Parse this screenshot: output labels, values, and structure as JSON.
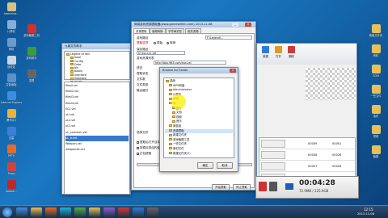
{
  "desktop_left": [
    {
      "label": "Administr...",
      "color": "#d8c089"
    },
    {
      "label": "计算机",
      "color": "#7fb0de"
    },
    {
      "label": "网络",
      "color": "#6a9bd0"
    },
    {
      "label": "回收站",
      "color": "#c8d6e6"
    },
    {
      "label": "控制面板",
      "color": "#5f91c9"
    },
    {
      "label": "Internet Explorer",
      "color": "#3c8fe0"
    },
    {
      "label": "腾讯QQ",
      "color": "#f0b030"
    },
    {
      "label": "迅雷",
      "color": "#3a7fd5"
    },
    {
      "label": "PPTV",
      "color": "#e86a2a"
    },
    {
      "label": "Fraps",
      "color": "#d0453b"
    },
    {
      "label": "Adobe...",
      "color": "#c02828"
    }
  ],
  "desktop_col2": [
    {
      "label": "游戏截图工具",
      "color": "#c33"
    },
    {
      "label": "游戏助手",
      "color": "#3b9b3b"
    },
    {
      "label": "录屏",
      "color": "#666"
    }
  ],
  "desktop_right": [
    {
      "label": "新建文件夹",
      "color": "#e6c15a"
    },
    {
      "label": "资料",
      "color": "#e6c15a"
    },
    {
      "label": "GOM",
      "color": "#e6c15a"
    },
    {
      "label": "一些文件",
      "color": "#e6c15a"
    },
    {
      "label": "素材",
      "color": "#e6c15a"
    },
    {
      "label": "视频",
      "color": "#e6c15a"
    },
    {
      "label": "截图",
      "color": "#e6c15a"
    }
  ],
  "file_window": {
    "title": "九鼎文件助手",
    "tree": [
      "Legend of Wiz",
      "base",
      "Config",
      "Data",
      "bin",
      "books",
      "interface",
      "mabiaoq",
      "music"
    ],
    "files": [
      "filesll.vel",
      "filesl2.vel",
      "filesl3.vel",
      "filesl4.vel",
      "ECL.vel",
      "uLl.vel",
      "uL2.vel",
      "uL3.vel",
      "uL_common.vel",
      "uL_b.vel",
      "Weapon.vel",
      "weaponeb.vel"
    ]
  },
  "main_window": {
    "title": "简易游戏资源提取器(www.gamewithin.com) 2013.11.08",
    "tabs": [
      "资源提取",
      "音频转换",
      "字符串浏览",
      "相关资源"
    ],
    "labels": [
      "游戏路径",
      "提取选项",
      "保存路径",
      "游戏资源列表",
      "语言",
      "提取状态",
      "文件数",
      "文件类型",
      "输出格式",
      "选择文件"
    ],
    "path_value": "F:\\Legend\\...",
    "save_value": "D:\\sss.ccc.vel",
    "url_value": "http://bbs.963.com/aaa.vel",
    "options": [
      "原始",
      "转换"
    ],
    "checkboxes": [
      "提取后打开目录",
      "覆盖已存在的文件",
      "按原目录结构保存",
      "跳过空文件",
      "打包提取",
      "自动识别格式"
    ],
    "start_button": "开始提取",
    "stop_button": "停止提取"
  },
  "dialog": {
    "title": "Browse for Folder",
    "items": [
      "桌面",
      "WPS网盘",
      "Administrator",
      "计算机",
      "网络",
      "库",
      "图片",
      "文档",
      "视频",
      "音乐",
      "家庭组",
      "资源提取",
      "新建文件夹",
      "游戏截图工具",
      "一些文件夹",
      "素材文件",
      "新建文件夹(2)"
    ],
    "ok": "确定",
    "cancel": "取消"
  },
  "right_window": {
    "toolbar": [
      "新建",
      "打开",
      "删除"
    ],
    "rows": [
      {
        "name": "00009",
        "size": "00001"
      },
      {
        "name": "00008",
        "size": "00028"
      },
      {
        "name": "00007",
        "size": "00026"
      },
      {
        "name": "00006",
        "size": "00024"
      },
      {
        "name": "00005",
        "size": "00022"
      }
    ]
  },
  "recorder": {
    "time": "00:04:28",
    "size": "72.9MB / 125.9GB"
  },
  "taskbar": {
    "items": [
      "start",
      "ie",
      "explorer",
      "media",
      "qq",
      "chrome",
      "folder",
      "app1",
      "app2",
      "app3"
    ],
    "clock_time": "12:15",
    "clock_date": "2013-11-08"
  }
}
